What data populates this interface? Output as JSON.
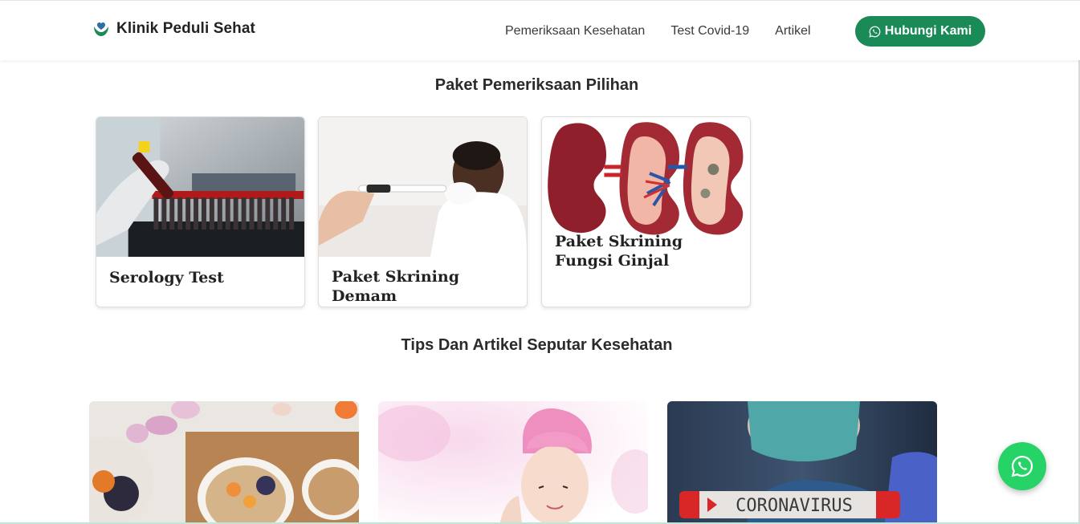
{
  "brand": {
    "name": "Klinik Peduli Sehat",
    "logo": "leaf-heart-icon"
  },
  "nav": {
    "links": [
      "Pemeriksaan Kesehatan",
      "Test Covid-19",
      "Artikel"
    ],
    "contact_label": "Hubungi Kami",
    "contact_icon": "whatsapp-icon"
  },
  "packages": {
    "title": "Paket Pemeriksaan Pilihan",
    "items": [
      {
        "title": "Serology Test",
        "image": "blood-sample-tubes-photo"
      },
      {
        "title": "Paket Skrining Demam",
        "image": "thermometer-sick-man-photo"
      },
      {
        "title": "Paket Skrining Fungsi Ginjal",
        "image": "kidney-illustration"
      }
    ]
  },
  "articles": {
    "title": "Tips Dan Artikel Seputar Kesehatan",
    "items": [
      {
        "image": "healthy-breakfast-bowl-photo"
      },
      {
        "image": "woman-skincare-photo"
      },
      {
        "image": "coronavirus-test-tube-photo",
        "image_text": "CORONAVIRUS"
      }
    ]
  },
  "floating": {
    "icon": "whatsapp-icon"
  },
  "colors": {
    "accent": "#1a8a57",
    "whatsapp": "#25d366",
    "text": "#2b2b2b"
  }
}
